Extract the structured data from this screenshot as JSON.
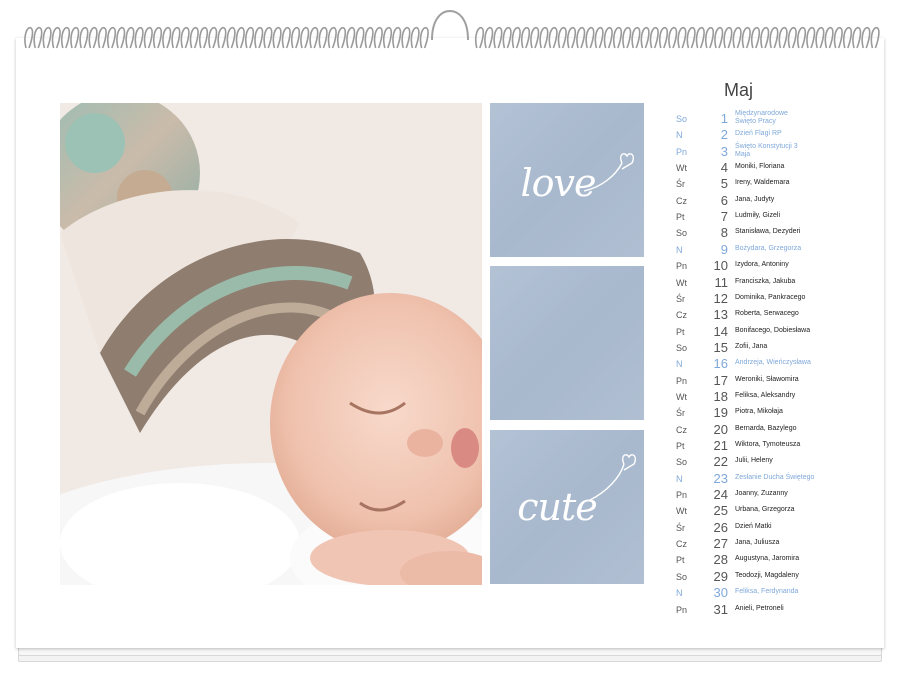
{
  "calendar": {
    "month": "Maj",
    "days": [
      {
        "dow": "So",
        "day": "1",
        "name": "Międzynarodowe Święto Pracy",
        "holiday": true
      },
      {
        "dow": "N",
        "day": "2",
        "name": "Dzień Flagi RP",
        "holiday": true
      },
      {
        "dow": "Pn",
        "day": "3",
        "name": "Święto Konstytucji 3 Maja",
        "holiday": true
      },
      {
        "dow": "Wt",
        "day": "4",
        "name": "Moniki, Floriana",
        "holiday": false
      },
      {
        "dow": "Śr",
        "day": "5",
        "name": "Ireny, Waldemara",
        "holiday": false
      },
      {
        "dow": "Cz",
        "day": "6",
        "name": "Jana, Judyty",
        "holiday": false
      },
      {
        "dow": "Pt",
        "day": "7",
        "name": "Ludmiły, Gizeli",
        "holiday": false
      },
      {
        "dow": "So",
        "day": "8",
        "name": "Stanisława, Dezyderi",
        "holiday": false
      },
      {
        "dow": "N",
        "day": "9",
        "name": "Bożydara, Grzegorza",
        "holiday": true
      },
      {
        "dow": "Pn",
        "day": "10",
        "name": "Izydora, Antoniny",
        "holiday": false
      },
      {
        "dow": "Wt",
        "day": "11",
        "name": "Franciszka, Jakuba",
        "holiday": false
      },
      {
        "dow": "Śr",
        "day": "12",
        "name": "Dominika, Pankracego",
        "holiday": false
      },
      {
        "dow": "Cz",
        "day": "13",
        "name": "Roberta, Serwacego",
        "holiday": false
      },
      {
        "dow": "Pt",
        "day": "14",
        "name": "Bonifacego, Dobiesława",
        "holiday": false
      },
      {
        "dow": "So",
        "day": "15",
        "name": "Zofii, Jana",
        "holiday": false
      },
      {
        "dow": "N",
        "day": "16",
        "name": "Andrzeja, Wieńczysława",
        "holiday": true
      },
      {
        "dow": "Pn",
        "day": "17",
        "name": "Weroniki, Sławomira",
        "holiday": false
      },
      {
        "dow": "Wt",
        "day": "18",
        "name": "Feliksa, Aleksandry",
        "holiday": false
      },
      {
        "dow": "Śr",
        "day": "19",
        "name": "Piotra, Mikołaja",
        "holiday": false
      },
      {
        "dow": "Cz",
        "day": "20",
        "name": "Bernarda, Bazylego",
        "holiday": false
      },
      {
        "dow": "Pt",
        "day": "21",
        "name": "Wiktora, Tymoteusza",
        "holiday": false
      },
      {
        "dow": "So",
        "day": "22",
        "name": "Julii, Heleny",
        "holiday": false
      },
      {
        "dow": "N",
        "day": "23",
        "name": "Zesłanie Ducha Świętego",
        "holiday": true
      },
      {
        "dow": "Pn",
        "day": "24",
        "name": "Joanny, Zuzanny",
        "holiday": false
      },
      {
        "dow": "Wt",
        "day": "25",
        "name": "Urbana, Grzegorza",
        "holiday": false
      },
      {
        "dow": "Śr",
        "day": "26",
        "name": "Dzień Matki",
        "holiday": false
      },
      {
        "dow": "Cz",
        "day": "27",
        "name": "Jana, Juliusza",
        "holiday": false
      },
      {
        "dow": "Pt",
        "day": "28",
        "name": "Augustyna, Jaromira",
        "holiday": false
      },
      {
        "dow": "So",
        "day": "29",
        "name": "Teodozji, Magdaleny",
        "holiday": false
      },
      {
        "dow": "N",
        "day": "30",
        "name": "Feliksa, Ferdynanda",
        "holiday": true
      },
      {
        "dow": "Pn",
        "day": "31",
        "name": "Anieli, Petroneli",
        "holiday": false
      }
    ]
  },
  "tiles": {
    "top_word": "love",
    "bottom_word": "cute"
  },
  "colors": {
    "tile_blue": "#abbbd0",
    "holiday_blue": "#7fa8d9"
  },
  "icons": {
    "binding": "wire-binding-icon",
    "heart": "heart-swirl-icon"
  }
}
